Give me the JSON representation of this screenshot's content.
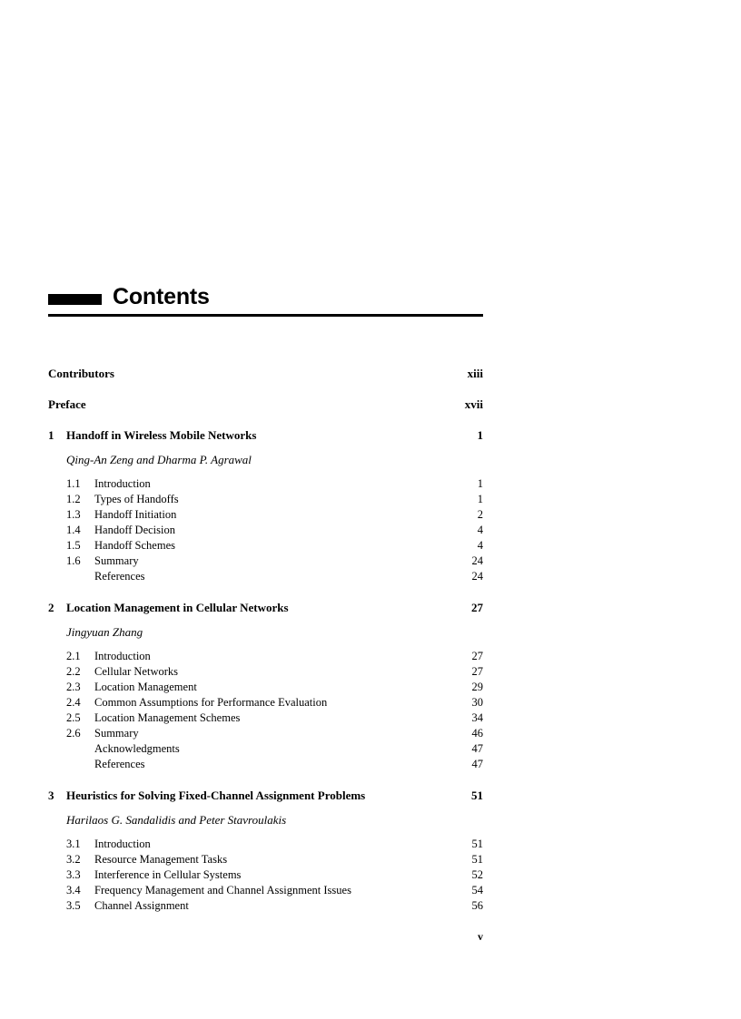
{
  "masthead": {
    "title": "Contents"
  },
  "front_matter": [
    {
      "label": "Contributors",
      "page": "xiii"
    },
    {
      "label": "Preface",
      "page": "xvii"
    }
  ],
  "chapters": [
    {
      "number": "1",
      "title": "Handoff in Wireless Mobile Networks",
      "page": "1",
      "authors": "Qing-An Zeng and Dharma P. Agrawal",
      "sections": [
        {
          "number": "1.1",
          "label": "Introduction",
          "page": "1"
        },
        {
          "number": "1.2",
          "label": "Types of Handoffs",
          "page": "1"
        },
        {
          "number": "1.3",
          "label": "Handoff Initiation",
          "page": "2"
        },
        {
          "number": "1.4",
          "label": "Handoff Decision",
          "page": "4"
        },
        {
          "number": "1.5",
          "label": "Handoff Schemes",
          "page": "4"
        },
        {
          "number": "1.6",
          "label": "Summary",
          "page": "24"
        },
        {
          "number": "",
          "label": "References",
          "page": "24"
        }
      ]
    },
    {
      "number": "2",
      "title": "Location Management in Cellular Networks",
      "page": "27",
      "authors": "Jingyuan Zhang",
      "sections": [
        {
          "number": "2.1",
          "label": "Introduction",
          "page": "27"
        },
        {
          "number": "2.2",
          "label": "Cellular Networks",
          "page": "27"
        },
        {
          "number": "2.3",
          "label": "Location Management",
          "page": "29"
        },
        {
          "number": "2.4",
          "label": "Common Assumptions for Performance Evaluation",
          "page": "30"
        },
        {
          "number": "2.5",
          "label": "Location Management Schemes",
          "page": "34"
        },
        {
          "number": "2.6",
          "label": "Summary",
          "page": "46"
        },
        {
          "number": "",
          "label": "Acknowledgments",
          "page": "47"
        },
        {
          "number": "",
          "label": "References",
          "page": "47"
        }
      ]
    },
    {
      "number": "3",
      "title": "Heuristics for Solving Fixed-Channel Assignment Problems",
      "page": "51",
      "authors": "Harilaos G. Sandalidis and Peter Stavroulakis",
      "sections": [
        {
          "number": "3.1",
          "label": "Introduction",
          "page": "51"
        },
        {
          "number": "3.2",
          "label": "Resource Management Tasks",
          "page": "51"
        },
        {
          "number": "3.3",
          "label": "Interference in Cellular Systems",
          "page": "52"
        },
        {
          "number": "3.4",
          "label": "Frequency Management and Channel Assignment Issues",
          "page": "54"
        },
        {
          "number": "3.5",
          "label": "Channel Assignment",
          "page": "56"
        }
      ]
    }
  ],
  "folio": {
    "page_number": "v"
  }
}
